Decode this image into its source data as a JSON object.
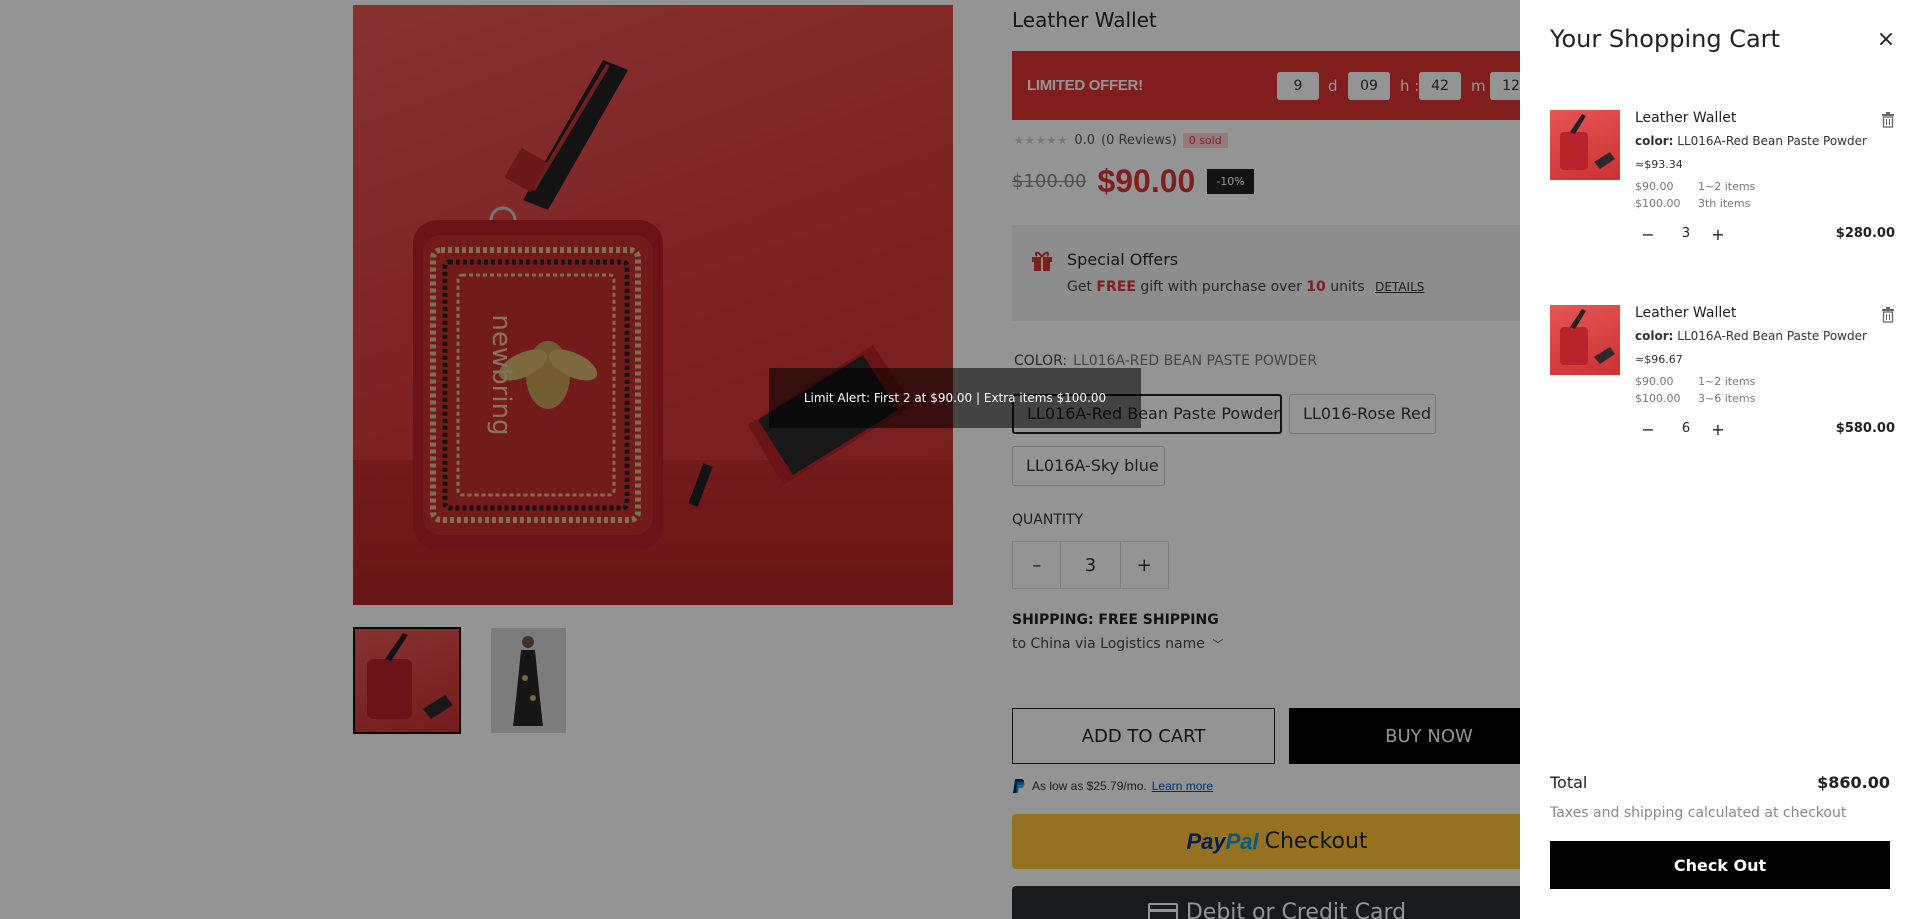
{
  "product": {
    "title": "Leather Wallet",
    "limited_offer_label": "LIMITED OFFER!",
    "countdown": {
      "days": "9",
      "days_unit": "d",
      "hours": "09",
      "hours_unit": "h :",
      "minutes": "42",
      "minutes_unit": "m :",
      "seconds": "12"
    },
    "rating": "0.0",
    "reviews": "(0 Reviews)",
    "sold": "0 sold",
    "old_price": "$100.00",
    "price": "$90.00",
    "discount": "-10%",
    "special_offers": {
      "title": "Special Offers",
      "desc_prefix": "Get ",
      "desc_free": "FREE",
      "desc_mid": " gift with purchase over ",
      "desc_count": "10",
      "desc_suffix": " units",
      "details_link": "DETAILS"
    },
    "color_label": "COLOR:",
    "color_value": "LL016A-RED BEAN PASTE POWDER",
    "color_options": [
      "LL016A-Red Bean Paste Powder",
      "LL016-Rose Red",
      "LL016A-Sky blue"
    ],
    "quantity_label": "QUANTITY",
    "quantity_value": "3",
    "shipping_label": "SHIPPING: FREE SHIPPING",
    "shipping_sub": "to China via Logistics name",
    "add_to_cart": "ADD TO CART",
    "buy_now": "BUY NOW",
    "paypal_note": "As low as $25.79/mo.",
    "learn_more": "Learn more",
    "paypal_pay": "Pay",
    "paypal_pal": "Pal",
    "paypal_checkout": "Checkout",
    "debit_credit": "Debit or Credit Card"
  },
  "tooltip": "Limit Alert: First 2 at $90.00 | Extra items $100.00",
  "cart": {
    "title": "Your Shopping Cart",
    "items": [
      {
        "name": "Leather Wallet",
        "color_key": "color:",
        "color_val": "LL016A-Red Bean Paste Powder",
        "approx": "≈$93.34",
        "tier1_price": "$90.00",
        "tier1_qty": "1~2 items",
        "tier2_price": "$100.00",
        "tier2_qty": "3th items",
        "qty": "3",
        "total": "$280.00"
      },
      {
        "name": "Leather Wallet",
        "color_key": "color:",
        "color_val": "LL016A-Red Bean Paste Powder",
        "approx": "≈$96.67",
        "tier1_price": "$90.00",
        "tier1_qty": "1~2 items",
        "tier2_price": "$100.00",
        "tier2_qty": "3~6 items",
        "qty": "6",
        "total": "$580.00"
      }
    ],
    "total_label": "Total",
    "total_value": "$860.00",
    "tax_note": "Taxes and shipping calculated at checkout",
    "checkout": "Check Out"
  }
}
